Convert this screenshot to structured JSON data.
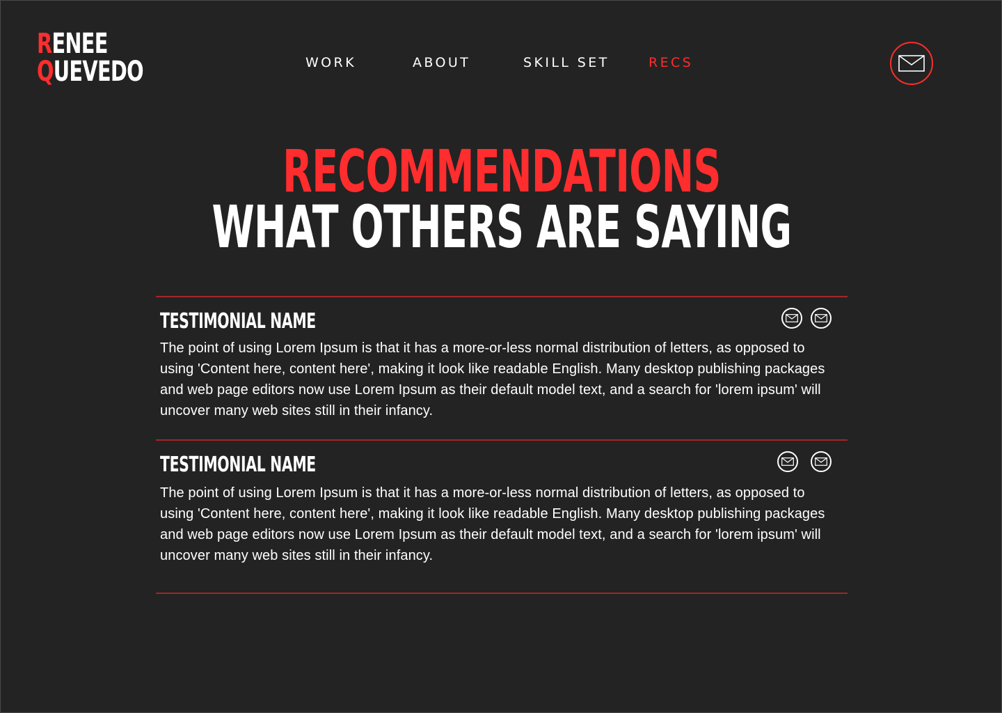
{
  "logo": {
    "first_initial": "R",
    "first_rest": "ENEE",
    "last_initial": "Q",
    "last_rest": "UEVEDO"
  },
  "nav": {
    "items": [
      {
        "label": "WORK"
      },
      {
        "label": "ABOUT"
      },
      {
        "label": "SKILL SET"
      },
      {
        "label": "RECS",
        "active": true
      }
    ]
  },
  "header": {
    "mail_icon": "envelope-icon"
  },
  "main": {
    "title": "RECOMMENDATIONS",
    "subtitle": "WHAT OTHERS ARE SAYING",
    "testimonials": [
      {
        "name": "TESTIMONIAL NAME",
        "body": "The point of using Lorem Ipsum is that it has a more-or-less normal distribution of letters, as opposed to using 'Content here, content here', making it look like readable English. Many desktop publishing packages and web page editors now use Lorem Ipsum as their default model text, and a search for 'lorem ipsum' will uncover many web sites still in their infancy.",
        "icons": [
          "envelope-icon",
          "envelope-icon"
        ]
      },
      {
        "name": "TESTIMONIAL NAME",
        "body": "The point of using Lorem Ipsum is that it has a more-or-less normal distribution of letters, as opposed to using 'Content here, content here', making it look like readable English. Many desktop publishing packages and web page editors now use Lorem Ipsum as their default model text, and a search for 'lorem ipsum' will uncover many web sites still in their infancy.",
        "icons": [
          "envelope-icon",
          "envelope-icon"
        ]
      }
    ]
  },
  "colors": {
    "background": "#232323",
    "accent": "#ff2d2d",
    "divider": "#a3262a",
    "text": "#ffffff"
  }
}
